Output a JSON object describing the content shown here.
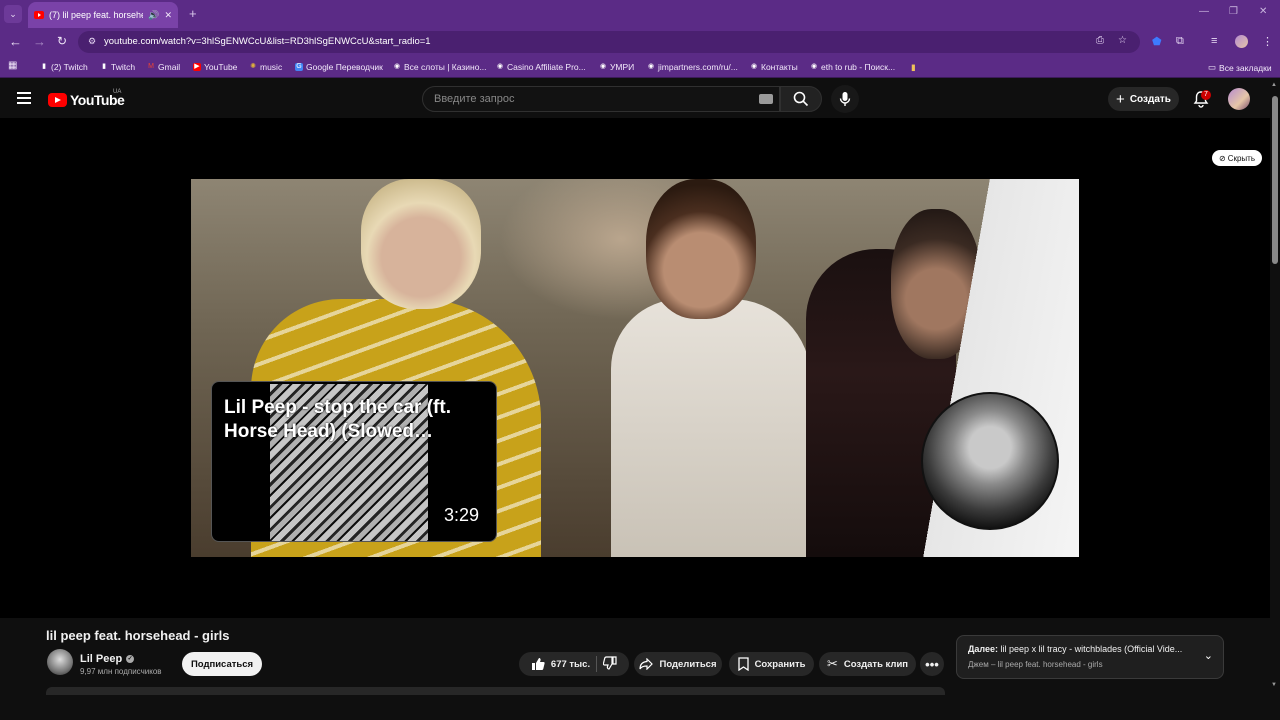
{
  "browser": {
    "tab_title": "(7) lil peep feat. horsehead",
    "url": "youtube.com/watch?v=3hlSgENWCcU&list=RD3hlSgENWCcU&start_radio=1",
    "bookmarks": [
      {
        "label": "(2) Twitch",
        "icon": "twitch-icon",
        "color": "#9146ff"
      },
      {
        "label": "Twitch",
        "icon": "twitch-icon",
        "color": "#9146ff"
      },
      {
        "label": "Gmail",
        "icon": "gmail-icon",
        "color": "#ea4335"
      },
      {
        "label": "YouTube",
        "icon": "youtube-icon",
        "color": "#ff0000"
      },
      {
        "label": "music",
        "icon": "music-icon",
        "color": "#e0b33a"
      },
      {
        "label": "Google Переводчик",
        "icon": "translate-icon",
        "color": "#4285f4"
      },
      {
        "label": "Все слоты | Казино...",
        "icon": "globe-icon",
        "color": "#ffffff"
      },
      {
        "label": "Casino Affiliate Pro...",
        "icon": "globe-icon",
        "color": "#ffffff"
      },
      {
        "label": "УМРИ",
        "icon": "globe-icon",
        "color": "#ffffff"
      },
      {
        "label": "jimpartners.com/ru/...",
        "icon": "globe-icon",
        "color": "#ffffff"
      },
      {
        "label": "Контакты",
        "icon": "globe-icon",
        "color": "#ffffff"
      },
      {
        "label": "eth to rub - Поиск...",
        "icon": "globe-icon",
        "color": "#ffffff"
      }
    ],
    "all_bookmarks": "Все закладки"
  },
  "youtube": {
    "logo_text": "YouTube",
    "region": "UA",
    "search_placeholder": "Введите запрос",
    "create_label": "Создать",
    "notifications_count": "7",
    "hide_label": "Скрыть"
  },
  "player": {
    "endscreen_card_title": "Lil Peep - stop the car (ft. Horse Head) (Slowed…",
    "endscreen_card_duration": "3:29"
  },
  "video": {
    "title": "lil peep feat. horsehead - girls",
    "channel": "Lil Peep",
    "subscribers": "9,97 млн подписчиков",
    "subscribe_label": "Подписаться",
    "likes": "677 тыс.",
    "share_label": "Поделиться",
    "save_label": "Сохранить",
    "clip_label": "Создать клип"
  },
  "up_next": {
    "prefix": "Далее:",
    "title": "lil peep x lil tracy - witchblades (Official Vide...",
    "playlist": "Джем – lil peep feat. horsehead - girls"
  },
  "colors": {
    "chrome_purple": "#5b2b86",
    "yt_red": "#ff0000",
    "yt_bg": "#0f0f0f"
  }
}
